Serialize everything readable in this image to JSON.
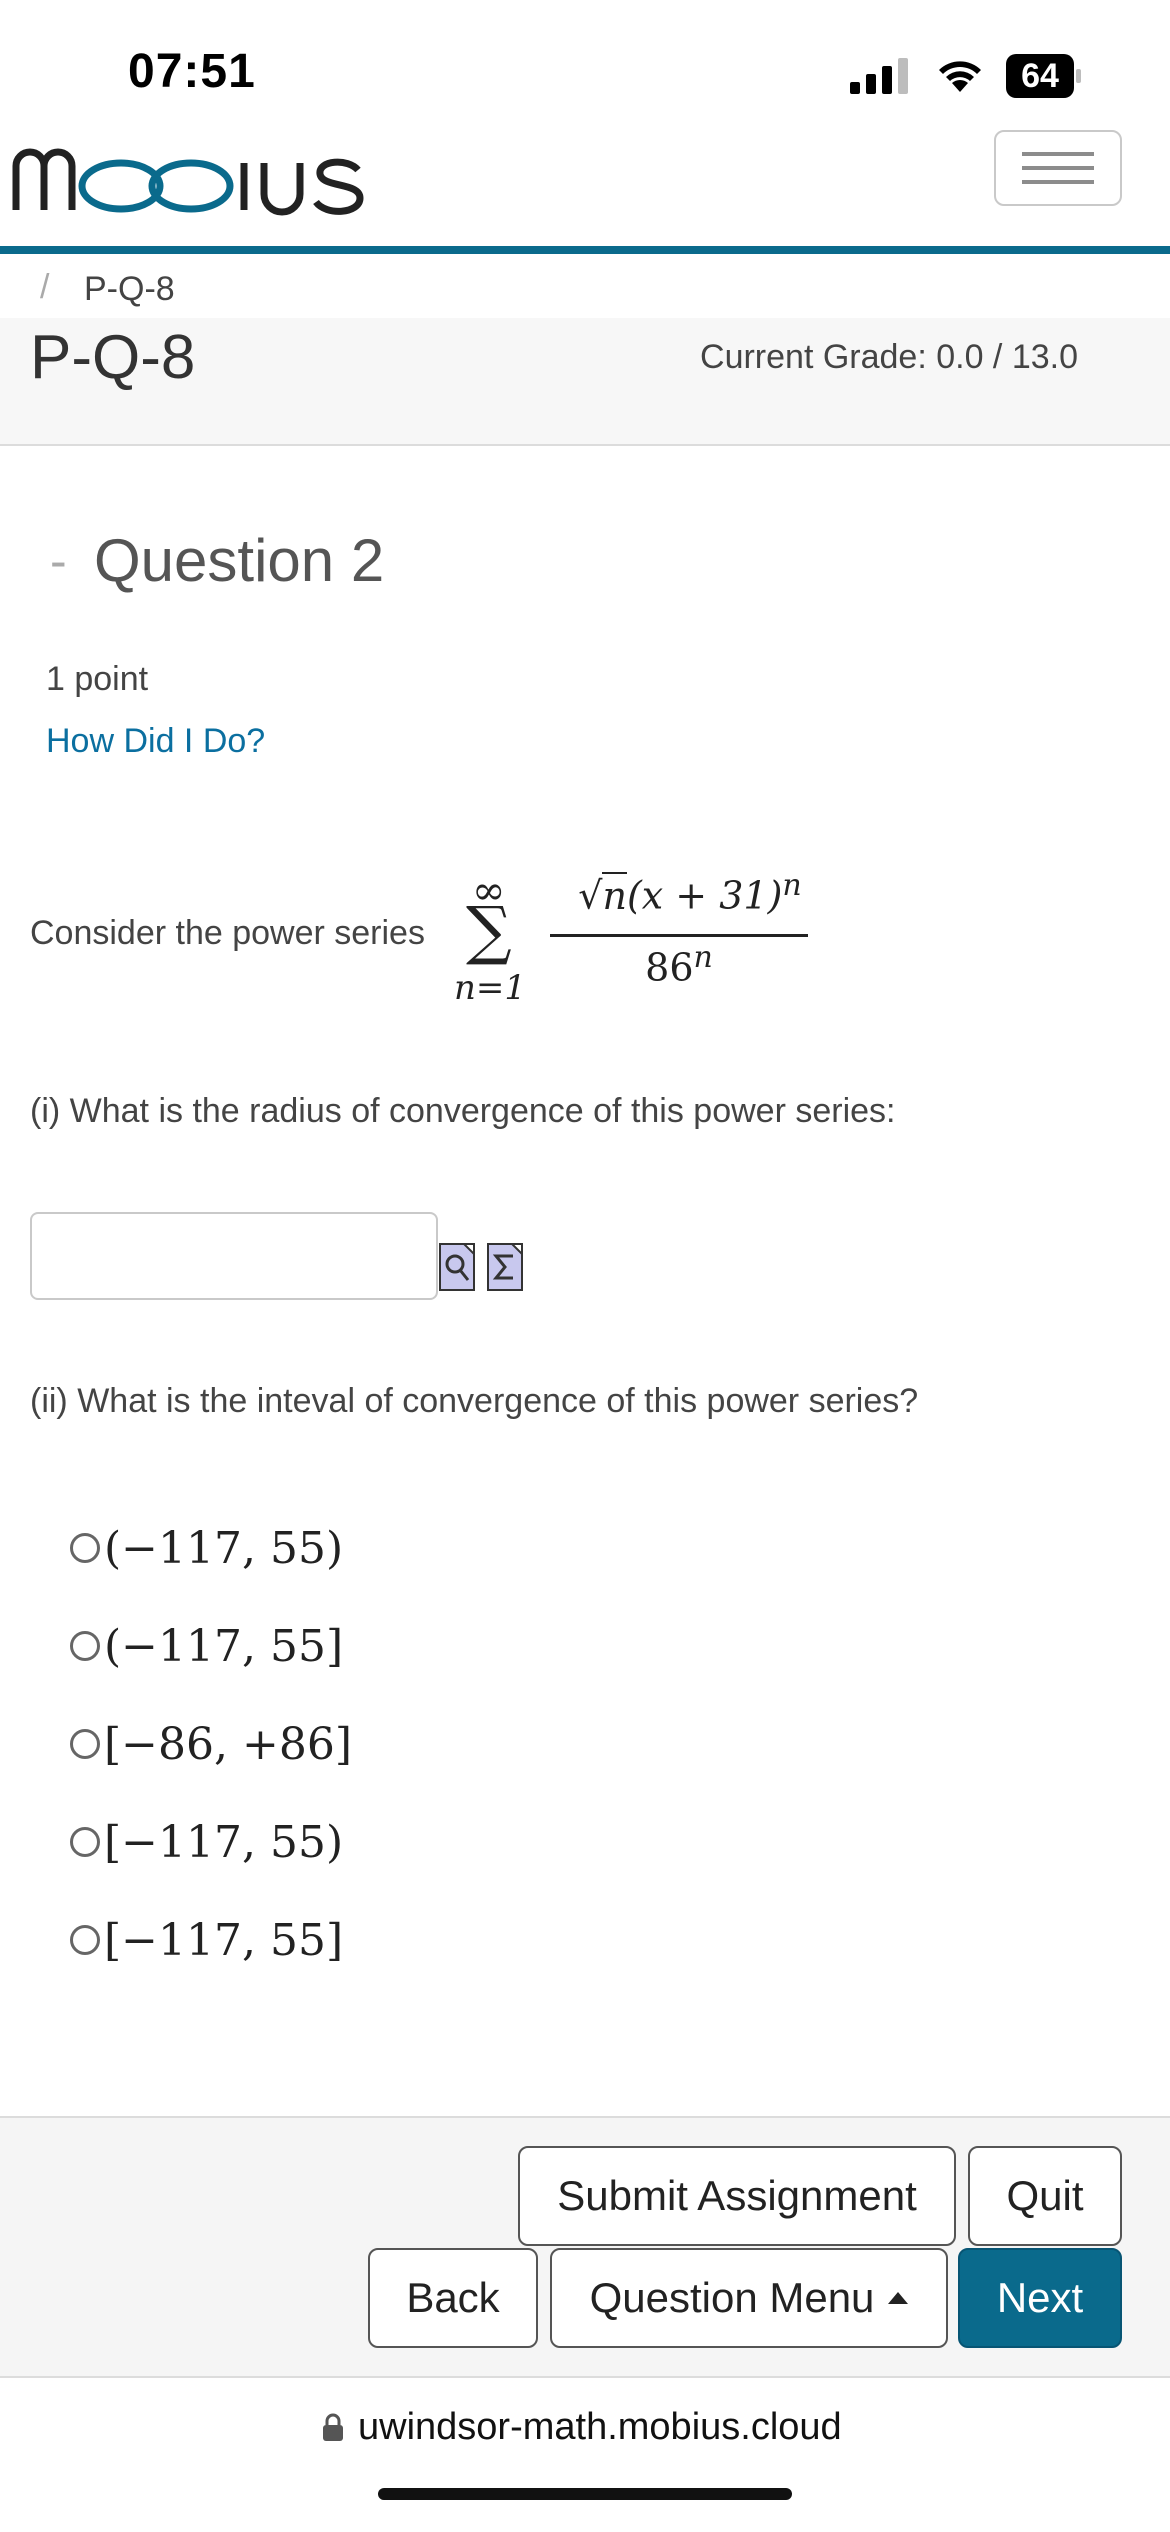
{
  "status_bar": {
    "time": "07:51",
    "battery": "64"
  },
  "header": {
    "logo_text": "mobius",
    "brand_color": "#0a6a8c"
  },
  "breadcrumb": {
    "separator": "/",
    "current": "P-Q-8"
  },
  "page": {
    "title": "P-Q-8",
    "grade": "Current Grade: 0.0 / 13.0"
  },
  "question": {
    "minus": "-",
    "title": "Question 2",
    "points": "1 point",
    "how_did_i_do": "How Did I Do?",
    "intro": "Consider the power series",
    "formula": {
      "sum_upper": "∞",
      "sum_symbol": "∑",
      "sum_lower": "n=1",
      "numerator_sqrt": "√",
      "numerator_radicand": "n",
      "numerator_rest": "(x + 31)",
      "numerator_exp": "n",
      "denominator_base": "86",
      "denominator_exp": "n"
    },
    "part1": "(i) What is the radius of convergence of this power series:",
    "answer_value": "",
    "part2": "(ii) What is the inteval of convergence of this power series?",
    "options": [
      "(−117, 55)",
      "(−117, 55]",
      "[−86, +86]",
      "[−117, 55)",
      "[−117, 55]"
    ]
  },
  "footer": {
    "submit": "Submit Assignment",
    "quit": "Quit",
    "back": "Back",
    "question_menu": "Question Menu",
    "next": "Next"
  },
  "browser": {
    "url": "uwindsor-math.mobius.cloud"
  }
}
